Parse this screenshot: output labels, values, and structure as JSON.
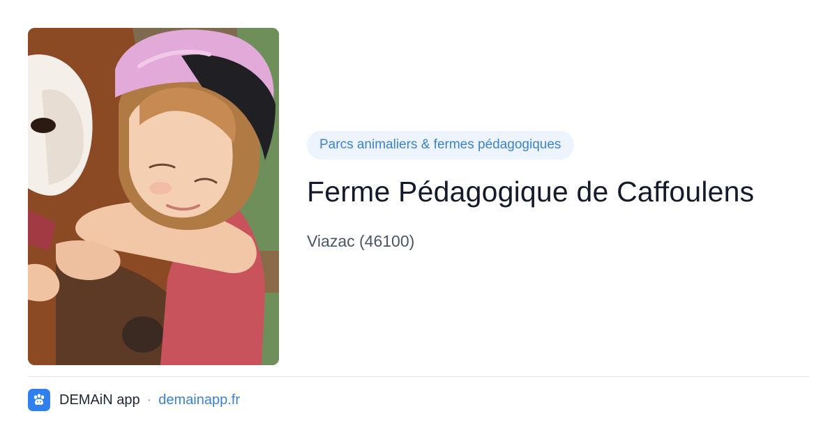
{
  "card": {
    "category": "Parcs animaliers & fermes pédagogiques",
    "title": "Ferme Pédagogique de Caffoulens",
    "location": "Viazac (46100)"
  },
  "footer": {
    "app_name": "DEMAiN app",
    "separator": "·",
    "domain": "demainapp.fr"
  },
  "colors": {
    "accent": "#3b82d6",
    "pill_background": "#edf4fd",
    "title": "#141a2a",
    "subtitle": "#4b5566",
    "app_icon": "#2f80ed"
  },
  "icons": {
    "app_logo": "paw-icon"
  }
}
